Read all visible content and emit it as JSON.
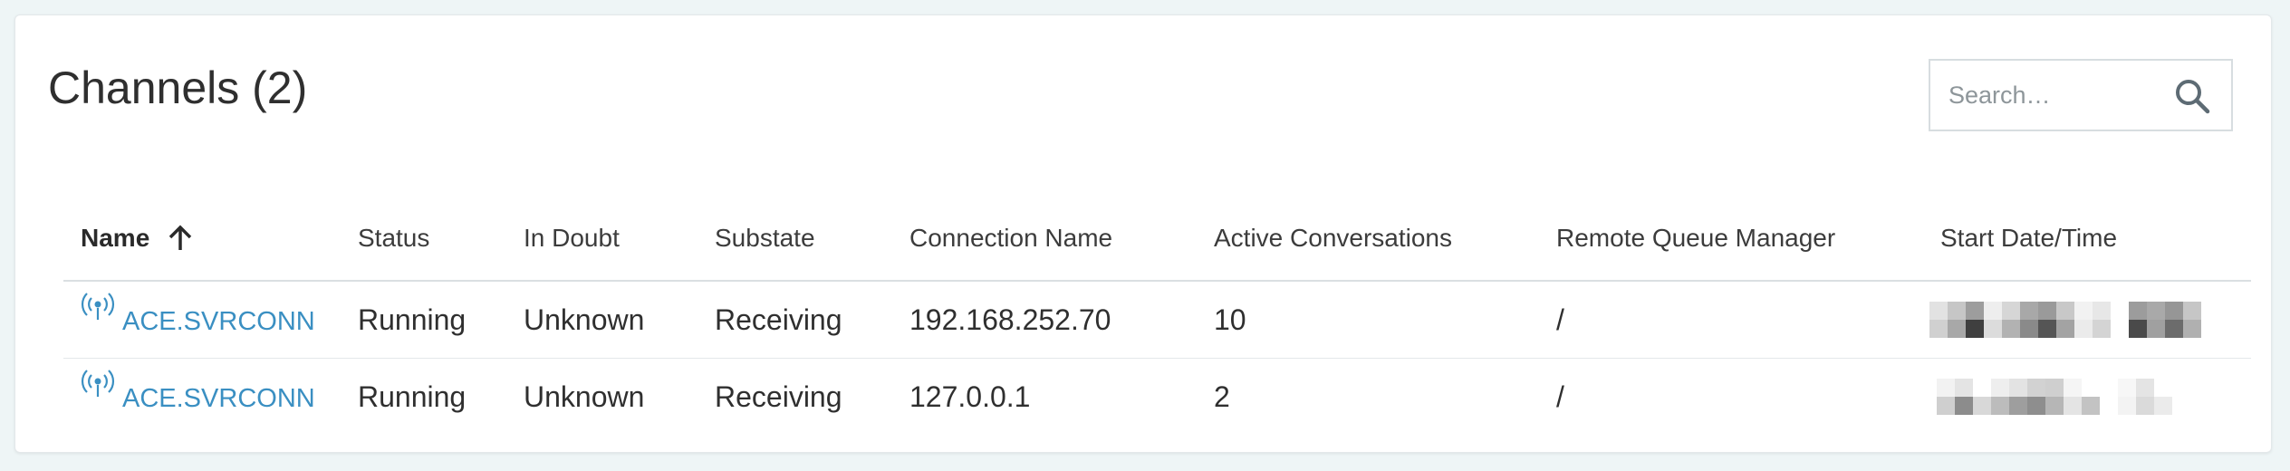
{
  "panel": {
    "title": "Channels (2)"
  },
  "search": {
    "placeholder": "Search…",
    "icon": "search-icon"
  },
  "table": {
    "columns": [
      "Name",
      "Status",
      "In Doubt",
      "Substate",
      "Connection Name",
      "Active Conversations",
      "Remote Queue Manager",
      "Start Date/Time"
    ],
    "sort": {
      "column": "Name",
      "direction": "ascending",
      "icon": "arrow-up-icon"
    },
    "rows": [
      {
        "name": "ACE.SVRCONN",
        "icon": "channel-broadcast-icon",
        "status": "Running",
        "in_doubt": "Unknown",
        "substate": "Receiving",
        "connection_name": "192.168.252.70",
        "active_conversations": "10",
        "remote_queue_manager": "/"
      },
      {
        "name": "ACE.SVRCONN",
        "icon": "channel-broadcast-icon",
        "status": "Running",
        "in_doubt": "Unknown",
        "substate": "Receiving",
        "connection_name": "127.0.0.1",
        "active_conversations": "2",
        "remote_queue_manager": "/"
      }
    ]
  },
  "colors": {
    "link": "#3a8fc2",
    "background": "#eef5f6",
    "card": "#ffffff"
  }
}
